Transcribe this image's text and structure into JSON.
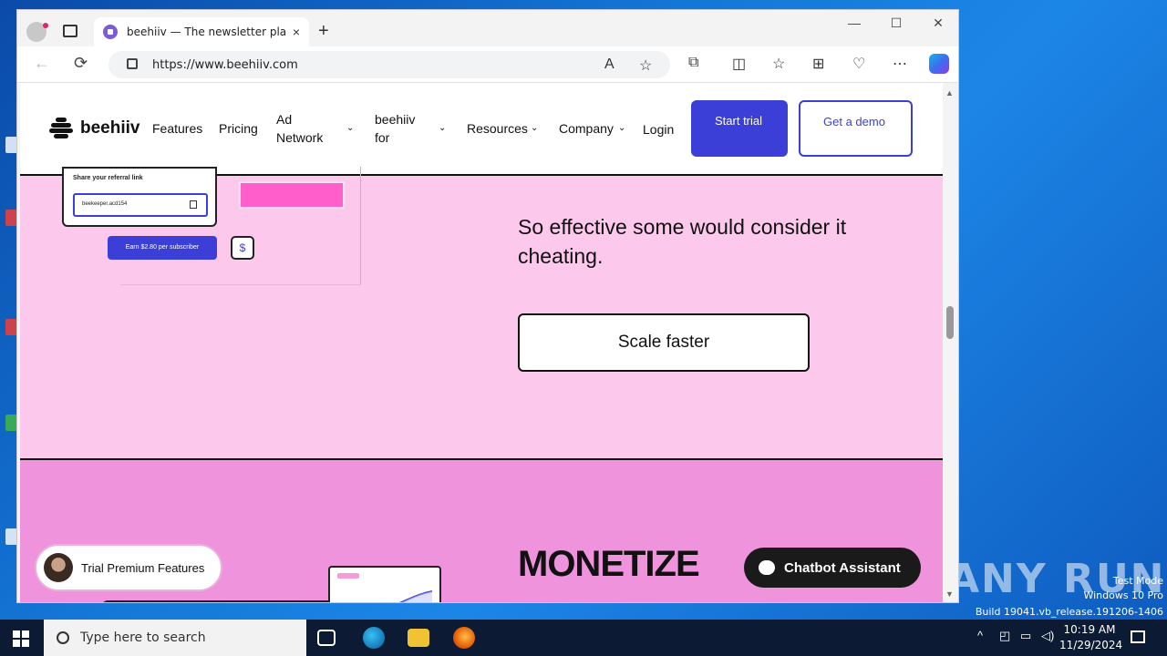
{
  "browser": {
    "tab_title": "beehiiv — The newsletter platform",
    "tab_close": "×",
    "new_tab": "+",
    "url": "https://www.beehiiv.com",
    "minimize": "—",
    "maximize": "☐",
    "close": "✕"
  },
  "site": {
    "logo_text": "beehiiv",
    "nav": {
      "features": "Features",
      "pricing": "Pricing",
      "ad_network": "Ad Network",
      "beehiiv_for": "beehiiv for",
      "resources": "Resources",
      "company": "Company",
      "login": "Login"
    },
    "start_trial": "Start trial",
    "get_demo": "Get a demo"
  },
  "section1": {
    "referral_title": "Share your referral link",
    "referral_value": "beekeeper.acd154",
    "earn_label": "Earn $2.80 per subscriber",
    "dollar_sign": "$",
    "headline": "So effective some would consider it cheating.",
    "cta": "Scale faster"
  },
  "section2": {
    "heading": "MONETIZE"
  },
  "widgets": {
    "trial_label": "Trial Premium Features",
    "chatbot_label": "Chatbot Assistant"
  },
  "taskbar": {
    "search_placeholder": "Type here to search",
    "time": "10:19 AM",
    "date": "11/29/2024"
  },
  "desktop": {
    "watermark_1": "Test Mode",
    "watermark_2": "Windows 10 Pro",
    "watermark_3": "Build 19041.vb_release.191206-1406",
    "anyrun": "ANY RUN"
  }
}
